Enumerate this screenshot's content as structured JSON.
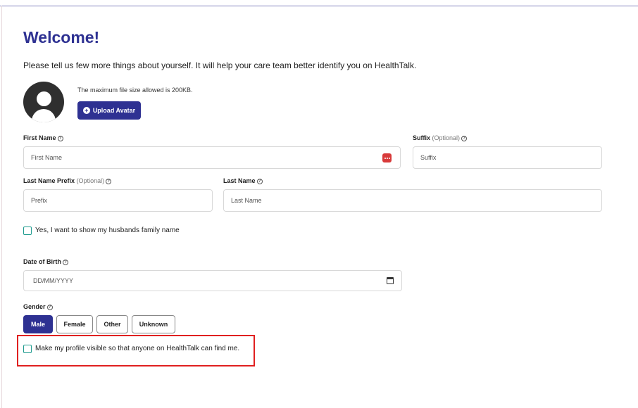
{
  "header": {
    "title": "Welcome!",
    "intro": "Please tell us few more things about yourself. It will help your care team better identify you on HealthTalk."
  },
  "avatar": {
    "file_note": "The maximum file size allowed is 200KB.",
    "upload_label": "Upload Avatar"
  },
  "fields": {
    "first_name": {
      "label": "First Name",
      "placeholder": "First Name",
      "value": ""
    },
    "suffix": {
      "label": "Suffix",
      "optional": "(Optional)",
      "placeholder": "Suffix",
      "value": ""
    },
    "last_name_prefix": {
      "label": "Last Name Prefix",
      "optional": "(Optional)",
      "placeholder": "Prefix",
      "value": ""
    },
    "last_name": {
      "label": "Last Name",
      "placeholder": "Last Name",
      "value": ""
    },
    "date_of_birth": {
      "label": "Date of Birth",
      "placeholder": "DD/MM/YYYY",
      "value": ""
    }
  },
  "husband_family_name": {
    "label": "Yes, I want to show my husbands family name",
    "checked": false
  },
  "gender": {
    "label": "Gender",
    "options": [
      "Male",
      "Female",
      "Other",
      "Unknown"
    ],
    "selected": "Male"
  },
  "profile_visible": {
    "label": "Make my profile visible so that anyone on HealthTalk can find me.",
    "checked": false
  },
  "icons": {
    "help": "question-circle-icon",
    "upload": "plus-circle-icon",
    "password_manager": "dots-icon",
    "calendar": "calendar-icon"
  },
  "colors": {
    "primary": "#2e3192",
    "checkbox": "#1f9b8f",
    "highlight": "#e02020",
    "autofill_badge": "#d83a3a"
  }
}
